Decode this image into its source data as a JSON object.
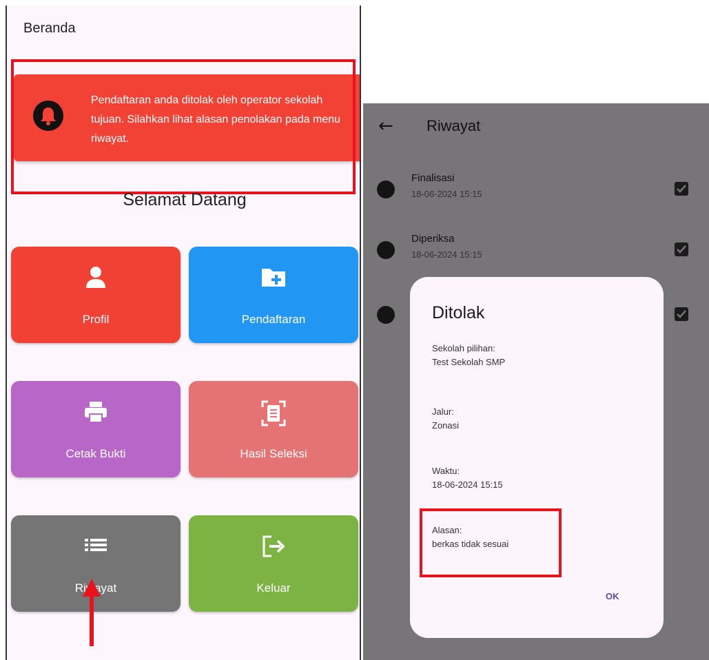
{
  "left": {
    "appbar_title": "Beranda",
    "banner_text": "Pendaftaran anda ditolak oleh operator sekolah tujuan. Silahkan lihat alasan penolakan pada menu riwayat.",
    "welcome": "Selamat Datang",
    "tiles": [
      {
        "label": "Profil",
        "icon": "person-icon",
        "color": "#f04134"
      },
      {
        "label": "Pendaftaran",
        "icon": "folder-add-icon",
        "color": "#2196f3"
      },
      {
        "label": "Cetak Bukti",
        "icon": "printer-icon",
        "color": "#b966c9"
      },
      {
        "label": "Hasil Seleksi",
        "icon": "document-scan-icon",
        "color": "#e57373"
      },
      {
        "label": "Riwayat",
        "icon": "list-icon",
        "color": "#757575"
      },
      {
        "label": "Keluar",
        "icon": "logout-icon",
        "color": "#7cb342"
      }
    ],
    "banner_color": "#f24236",
    "highlight_color": "#e8131c"
  },
  "right": {
    "appbar_title": "Riwayat",
    "items": [
      {
        "name": "Finalisasi",
        "time": "18-06-2024 15:15"
      },
      {
        "name": "Diperiksa",
        "time": "18-06-2024 15:15"
      },
      {
        "name": "",
        "time": ""
      }
    ],
    "dialog": {
      "title": "Ditolak",
      "sekolah_label": "Sekolah pilihan:",
      "sekolah_value": "Test Sekolah SMP",
      "jalur_label": "Jalur:",
      "jalur_value": "Zonasi",
      "waktu_label": "Waktu:",
      "waktu_value": "18-06-2024 15:15",
      "alasan_label": "Alasan:",
      "alasan_value": "berkas tidak sesuai",
      "ok_label": "OK"
    }
  }
}
